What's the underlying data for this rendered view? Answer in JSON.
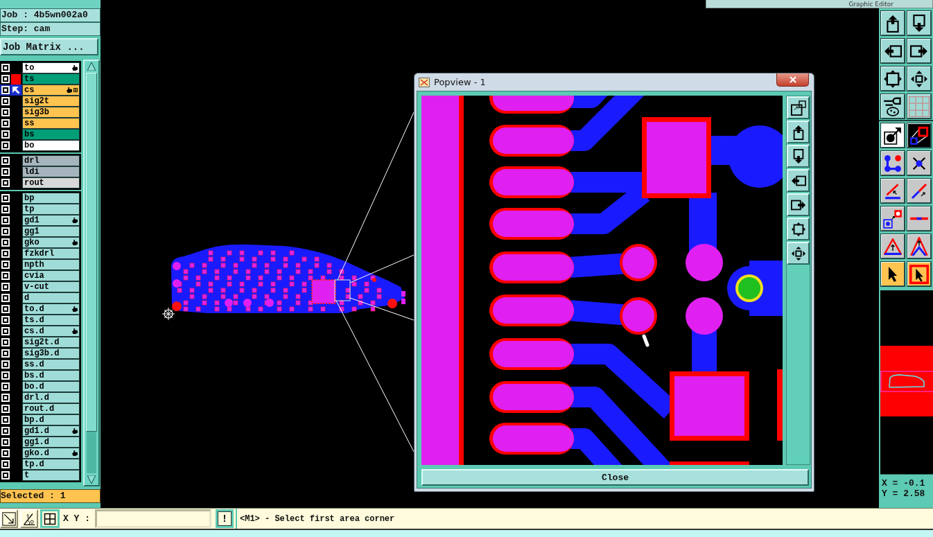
{
  "header": {
    "title": "Graphic Editor"
  },
  "job": {
    "job": "Job : 4b5wn002a0",
    "step": "Step: cam",
    "matrix_button": "Job Matrix ..."
  },
  "layer_groups": [
    {
      "layers": [
        {
          "name": "to",
          "color": "#ffffff",
          "selected": false,
          "displayed": false,
          "work": false,
          "flagged": true,
          "grid_mark": false
        },
        {
          "name": "ts",
          "color": "#009f78",
          "selected": false,
          "displayed": true,
          "work": false,
          "flagged": false,
          "grid_mark": false
        },
        {
          "name": "cs",
          "color": "#ffc34f",
          "selected": true,
          "displayed": false,
          "work": true,
          "flagged": true,
          "grid_mark": true
        },
        {
          "name": "sig2t",
          "color": "#ffc34f",
          "selected": false,
          "displayed": false,
          "work": false,
          "flagged": false,
          "grid_mark": false
        },
        {
          "name": "sig3b",
          "color": "#ffc34f",
          "selected": false,
          "displayed": false,
          "work": false,
          "flagged": false,
          "grid_mark": false
        },
        {
          "name": "ss",
          "color": "#ffc34f",
          "selected": false,
          "displayed": false,
          "work": false,
          "flagged": false,
          "grid_mark": false
        },
        {
          "name": "bs",
          "color": "#009f78",
          "selected": false,
          "displayed": false,
          "work": false,
          "flagged": false,
          "grid_mark": false
        },
        {
          "name": "bo",
          "color": "#ffffff",
          "selected": false,
          "displayed": false,
          "work": false,
          "flagged": false,
          "grid_mark": false
        }
      ]
    },
    {
      "layers": [
        {
          "name": "drl",
          "color": "#a6b5bd",
          "selected": false,
          "displayed": false,
          "work": false,
          "flagged": false,
          "grid_mark": false
        },
        {
          "name": "ldi",
          "color": "#a6b5bd",
          "selected": false,
          "displayed": false,
          "work": false,
          "flagged": false,
          "grid_mark": false
        },
        {
          "name": "rout",
          "color": "#d8d8d8",
          "selected": false,
          "displayed": false,
          "work": false,
          "flagged": false,
          "grid_mark": false
        }
      ]
    },
    {
      "layers": [
        {
          "name": "bp",
          "color": "#9fdcd8",
          "selected": false,
          "displayed": false,
          "work": false,
          "flagged": false,
          "grid_mark": false
        },
        {
          "name": "tp",
          "color": "#9fdcd8",
          "selected": false,
          "displayed": false,
          "work": false,
          "flagged": false,
          "grid_mark": false
        },
        {
          "name": "gd1",
          "color": "#9fdcd8",
          "selected": false,
          "displayed": false,
          "work": false,
          "flagged": true,
          "grid_mark": false
        },
        {
          "name": "gg1",
          "color": "#9fdcd8",
          "selected": false,
          "displayed": false,
          "work": false,
          "flagged": false,
          "grid_mark": false
        },
        {
          "name": "gko",
          "color": "#9fdcd8",
          "selected": false,
          "displayed": false,
          "work": false,
          "flagged": true,
          "grid_mark": false
        },
        {
          "name": "fzkdrl",
          "color": "#9fdcd8",
          "selected": false,
          "displayed": false,
          "work": false,
          "flagged": false,
          "grid_mark": false
        },
        {
          "name": "npth",
          "color": "#9fdcd8",
          "selected": false,
          "displayed": false,
          "work": false,
          "flagged": false,
          "grid_mark": false
        },
        {
          "name": "cvia",
          "color": "#9fdcd8",
          "selected": false,
          "displayed": false,
          "work": false,
          "flagged": false,
          "grid_mark": false
        },
        {
          "name": "v-cut",
          "color": "#9fdcd8",
          "selected": false,
          "displayed": false,
          "work": false,
          "flagged": false,
          "grid_mark": false
        },
        {
          "name": "d",
          "color": "#9fdcd8",
          "selected": false,
          "displayed": false,
          "work": false,
          "flagged": false,
          "grid_mark": false
        },
        {
          "name": "to.d",
          "color": "#9fdcd8",
          "selected": false,
          "displayed": false,
          "work": false,
          "flagged": true,
          "grid_mark": false
        },
        {
          "name": "ts.d",
          "color": "#9fdcd8",
          "selected": false,
          "displayed": false,
          "work": false,
          "flagged": false,
          "grid_mark": false
        },
        {
          "name": "cs.d",
          "color": "#9fdcd8",
          "selected": false,
          "displayed": false,
          "work": false,
          "flagged": true,
          "grid_mark": false
        },
        {
          "name": "sig2t.d",
          "color": "#9fdcd8",
          "selected": false,
          "displayed": false,
          "work": false,
          "flagged": false,
          "grid_mark": false
        },
        {
          "name": "sig3b.d",
          "color": "#9fdcd8",
          "selected": false,
          "displayed": false,
          "work": false,
          "flagged": false,
          "grid_mark": false
        },
        {
          "name": "ss.d",
          "color": "#9fdcd8",
          "selected": false,
          "displayed": false,
          "work": false,
          "flagged": false,
          "grid_mark": false
        },
        {
          "name": "bs.d",
          "color": "#9fdcd8",
          "selected": false,
          "displayed": false,
          "work": false,
          "flagged": false,
          "grid_mark": false
        },
        {
          "name": "bo.d",
          "color": "#9fdcd8",
          "selected": false,
          "displayed": false,
          "work": false,
          "flagged": false,
          "grid_mark": false
        },
        {
          "name": "drl.d",
          "color": "#9fdcd8",
          "selected": false,
          "displayed": false,
          "work": false,
          "flagged": false,
          "grid_mark": false
        },
        {
          "name": "rout.d",
          "color": "#9fdcd8",
          "selected": false,
          "displayed": false,
          "work": false,
          "flagged": false,
          "grid_mark": false
        },
        {
          "name": "bp.d",
          "color": "#9fdcd8",
          "selected": false,
          "displayed": false,
          "work": false,
          "flagged": false,
          "grid_mark": false
        },
        {
          "name": "gd1.d",
          "color": "#9fdcd8",
          "selected": false,
          "displayed": false,
          "work": false,
          "flagged": true,
          "grid_mark": false
        },
        {
          "name": "gg1.d",
          "color": "#9fdcd8",
          "selected": false,
          "displayed": false,
          "work": false,
          "flagged": false,
          "grid_mark": false
        },
        {
          "name": "gko.d",
          "color": "#9fdcd8",
          "selected": false,
          "displayed": false,
          "work": false,
          "flagged": true,
          "grid_mark": false
        },
        {
          "name": "tp.d",
          "color": "#9fdcd8",
          "selected": false,
          "displayed": false,
          "work": false,
          "flagged": false,
          "grid_mark": false
        },
        {
          "name": "t",
          "color": "#9fdcd8",
          "selected": false,
          "displayed": false,
          "work": false,
          "flagged": false,
          "grid_mark": false
        }
      ]
    }
  ],
  "selection": {
    "text": "Selected : 1"
  },
  "popview": {
    "title": "Popview - 1",
    "close_button": "Close"
  },
  "toolbar": {
    "buttons": [
      {
        "selected": false
      },
      {
        "selected": false
      },
      {
        "selected": false
      },
      {
        "selected": false
      },
      {
        "selected": false
      },
      {
        "selected": false
      },
      {
        "selected": false
      },
      {
        "selected": false
      },
      {
        "selected": false
      },
      {
        "selected": false
      },
      {
        "selected": false
      },
      {
        "selected": false
      },
      {
        "selected": false
      },
      {
        "selected": false
      },
      {
        "selected": false
      },
      {
        "selected": false
      },
      {
        "selected": false
      },
      {
        "selected": false
      },
      {
        "selected": true
      },
      {
        "selected": true
      }
    ]
  },
  "coordinates": {
    "x": "X = -0.1",
    "y": "Y = 2.58"
  },
  "command_bar": {
    "xy_label": "X Y :",
    "alert_button": "!",
    "message": "<M1> - Select first area corner"
  }
}
